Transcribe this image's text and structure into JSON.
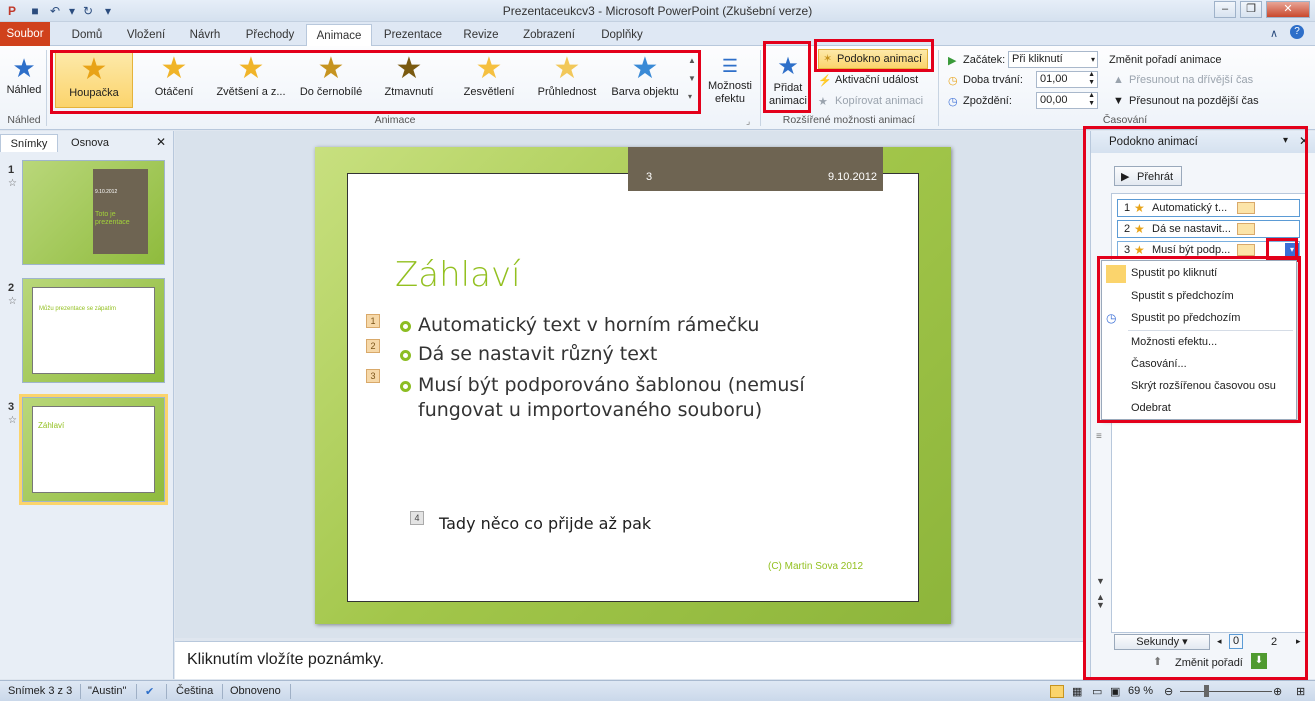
{
  "window": {
    "title": "Prezentaceukcv3 - Microsoft PowerPoint (Zkušební verze)"
  },
  "tabs": [
    "Soubor",
    "Domů",
    "Vložení",
    "Návrh",
    "Přechody",
    "Animace",
    "Prezentace",
    "Revize",
    "Zobrazení",
    "Doplňky"
  ],
  "ribbon": {
    "preview": {
      "label": "Náhled",
      "group": "Náhled"
    },
    "animations": [
      {
        "label": "Houpačka",
        "color": "#e8a317"
      },
      {
        "label": "Otáčení",
        "color": "#f0b429"
      },
      {
        "label": "Zvětšení a z...",
        "color": "#f0b429"
      },
      {
        "label": "Do černobílé",
        "color": "#c69420"
      },
      {
        "label": "Ztmavnutí",
        "color": "#7a5a10"
      },
      {
        "label": "Zesvětlení",
        "color": "#f5c040"
      },
      {
        "label": "Průhlednost",
        "color": "#f2c85a"
      },
      {
        "label": "Barva objektu",
        "color": "#3a8ad6"
      }
    ],
    "effect_options": "Možnosti efektu",
    "animations_group": "Animace",
    "add_animation": "Přidat animaci",
    "animation_pane_btn": "Podokno animací",
    "trigger": "Aktivační událost",
    "copy_animation": "Kopírovat animaci",
    "advanced_group": "Rozšířené možnosti animací",
    "start_label": "Začátek:",
    "start_value": "Při kliknutí",
    "duration_label": "Doba trvání:",
    "duration_value": "01,00",
    "delay_label": "Zpoždění:",
    "delay_value": "00,00",
    "reorder_title": "Změnit pořadí animace",
    "move_earlier": "Přesunout na dřívější čas",
    "move_later": "Přesunout na pozdější čas",
    "timing_group": "Časování"
  },
  "leftpane": {
    "tabs": [
      "Snímky",
      "Osnova"
    ],
    "thumbs": [
      {
        "num": "1",
        "title": "Toto je prezentace",
        "date": "9.10.2012"
      },
      {
        "num": "2",
        "title": "Můžu prezentace se zápatím"
      },
      {
        "num": "3",
        "title": "Záhlaví"
      }
    ]
  },
  "slide": {
    "number": "3",
    "date": "9.10.2012",
    "title": "Záhlaví",
    "bullets": [
      {
        "tag": "1",
        "text": "Automatický text v horním rámečku"
      },
      {
        "tag": "2",
        "text": "Dá se nastavit různý text"
      },
      {
        "tag": "3",
        "text": "Musí být podporováno šablonou (nemusí",
        "text2": "fungovat u importovaného souboru)"
      }
    ],
    "extra_tag": "4",
    "extra_text": "Tady něco co přijde až pak",
    "footer": "(C) Martin Sova 2012"
  },
  "notes": {
    "placeholder": "Kliknutím vložíte poznámky."
  },
  "animpane": {
    "title": "Podokno animací",
    "play": "Přehrát",
    "items": [
      {
        "num": "1",
        "label": "Automatický t..."
      },
      {
        "num": "2",
        "label": "Dá se nastavit..."
      },
      {
        "num": "3",
        "label": "Musí být podp..."
      }
    ],
    "menu": [
      "Spustit po kliknutí",
      "Spustit s předchozím",
      "Spustit po předchozím",
      "Možnosti efektu...",
      "Časování...",
      "Skrýt rozšířenou časovou osu",
      "Odebrat"
    ],
    "seconds": "Sekundy",
    "timeline_start": "0",
    "timeline_end": "2",
    "reorder": "Změnit pořadí"
  },
  "status": {
    "slide": "Snímek 3 z 3",
    "theme": "\"Austin\"",
    "language": "Čeština",
    "state": "Obnoveno",
    "zoom": "69 %"
  }
}
